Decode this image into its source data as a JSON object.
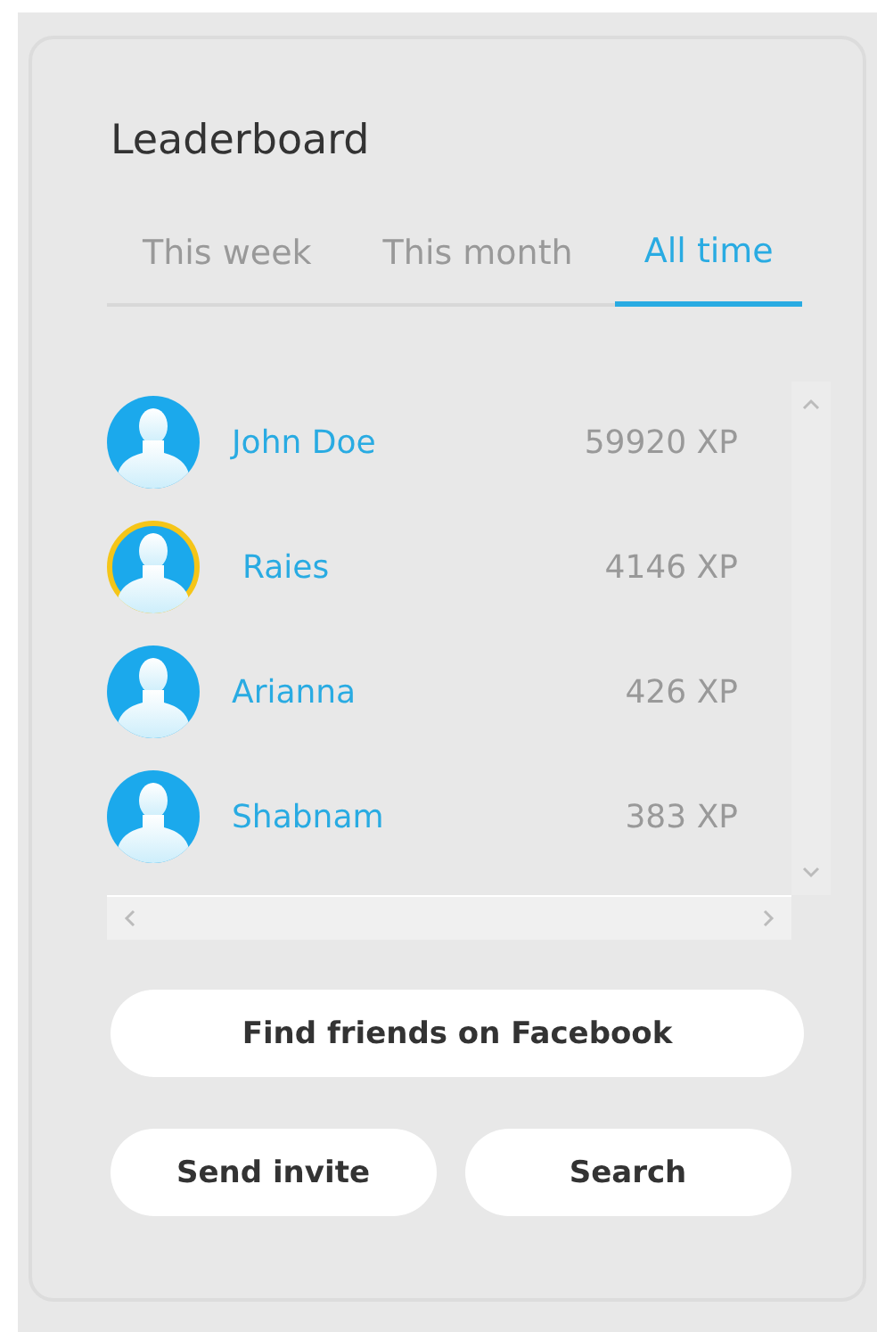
{
  "title": "Leaderboard",
  "tabs": [
    {
      "label": "This week",
      "selected": false
    },
    {
      "label": "This month",
      "selected": false
    },
    {
      "label": "All time",
      "selected": true
    }
  ],
  "players": [
    {
      "name": "John Doe",
      "xp": "59920 XP",
      "highlighted": false
    },
    {
      "name": "Raies",
      "xp": "4146 XP",
      "highlighted": true
    },
    {
      "name": "Arianna",
      "xp": "426 XP",
      "highlighted": false
    },
    {
      "name": "Shabnam",
      "xp": "383 XP",
      "highlighted": false
    }
  ],
  "buttons": [
    "Find friends on Facebook",
    "Send invite",
    "Search"
  ]
}
